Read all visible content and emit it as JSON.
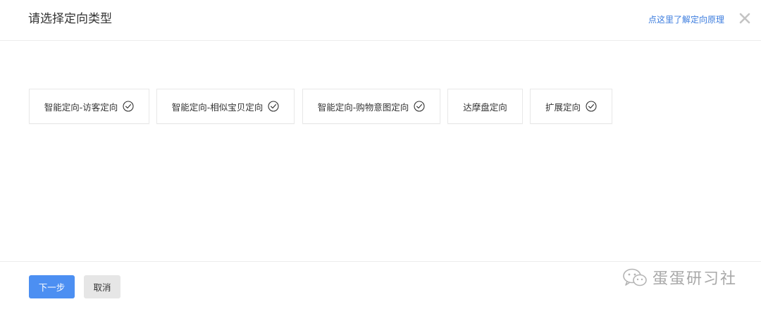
{
  "dialog": {
    "title": "请选择定向类型",
    "help_link": "点这里了解定向原理",
    "close_icon": "close-icon"
  },
  "options": [
    {
      "label": "智能定向-访客定向",
      "checked_icon": "check-circle-icon"
    },
    {
      "label": "智能定向-相似宝贝定向",
      "checked_icon": "check-circle-icon"
    },
    {
      "label": "智能定向-购物意图定向",
      "checked_icon": "check-circle-icon"
    },
    {
      "label": "达摩盘定向"
    },
    {
      "label": "扩展定向",
      "checked_icon": "check-circle-icon"
    }
  ],
  "footer": {
    "next_label": "下一步",
    "cancel_label": "取消"
  },
  "watermark": {
    "text": "蛋蛋研习社",
    "icon": "wechat-icon"
  },
  "colors": {
    "primary": "#4c8ff2",
    "link": "#3b7cde",
    "border": "#e8e8e8",
    "cancel_bg": "#e6e6e6"
  }
}
